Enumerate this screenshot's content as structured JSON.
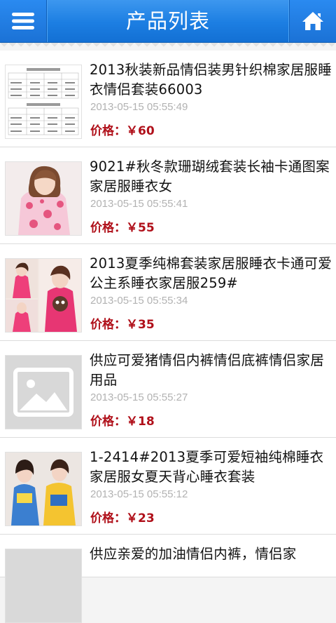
{
  "header": {
    "title": "产品列表"
  },
  "products": [
    {
      "name": "2013秋装新品情侣装男针织棉家居服睡衣情侣套装66003",
      "date": "2013-05-15 05:55:49",
      "price": "价格：￥60",
      "thumb": "size-chart-image"
    },
    {
      "name": "9021#秋冬款珊瑚绒套装长袖卡通图案家居服睡衣女",
      "date": "2013-05-15 05:55:41",
      "price": "价格：￥55",
      "thumb": "model-photo-pink-pajamas"
    },
    {
      "name": "2013夏季纯棉套装家居服睡衣卡通可爱公主系睡衣家居服259#",
      "date": "2013-05-15 05:55:34",
      "price": "价格：￥35",
      "thumb": "model-photo-collage"
    },
    {
      "name": "供应可爱猪情侣内裤情侣底裤情侣家居用品",
      "date": "2013-05-15 05:55:27",
      "price": "价格：￥18",
      "thumb": "image-placeholder-icon"
    },
    {
      "name": "1-2414#2013夏季可爱短袖纯棉睡衣家居服女夏天背心睡衣套装",
      "date": "2013-05-15 05:55:12",
      "price": "价格：￥23",
      "thumb": "model-photo-two-girls"
    },
    {
      "name": "供应亲爱的加油情侣内裤，情侣家"
    }
  ],
  "colors": {
    "header": "#1c7ee2",
    "price": "#b0101a",
    "date": "#b2b2b2"
  }
}
